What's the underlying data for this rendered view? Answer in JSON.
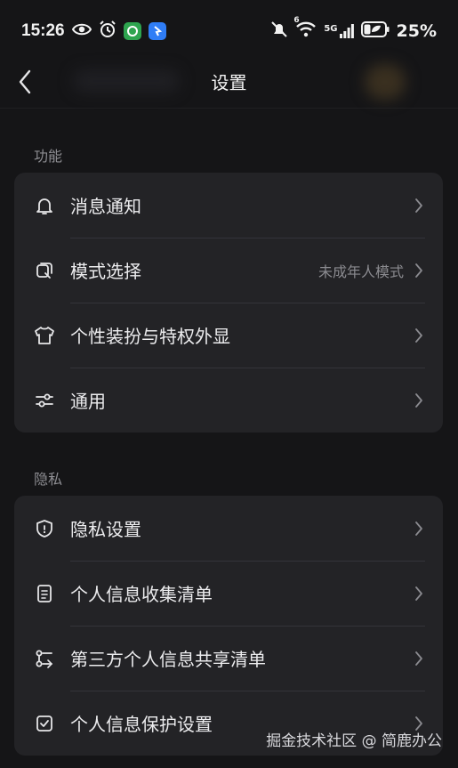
{
  "status_bar": {
    "time": "15:26",
    "battery": "25%",
    "network": "5G",
    "wifi_badge": "6"
  },
  "header": {
    "title": "设置"
  },
  "sections": [
    {
      "label": "功能",
      "items": [
        {
          "label": "消息通知",
          "icon": "bell-icon",
          "value": ""
        },
        {
          "label": "模式选择",
          "icon": "mode-switch-icon",
          "value": "未成年人模式"
        },
        {
          "label": "个性装扮与特权外显",
          "icon": "shirt-icon",
          "value": ""
        },
        {
          "label": "通用",
          "icon": "sliders-icon",
          "value": ""
        }
      ]
    },
    {
      "label": "隐私",
      "items": [
        {
          "label": "隐私设置",
          "icon": "shield-icon",
          "value": ""
        },
        {
          "label": "个人信息收集清单",
          "icon": "document-icon",
          "value": ""
        },
        {
          "label": "第三方个人信息共享清单",
          "icon": "share-icon",
          "value": ""
        },
        {
          "label": "个人信息保护设置",
          "icon": "checkbox-icon",
          "value": ""
        }
      ]
    }
  ],
  "watermark": "掘金技术社区 @ 简鹿办公",
  "colors": {
    "background": "#151517",
    "card": "#232326",
    "text": "#ececee",
    "secondary_text": "#8b8b90"
  }
}
